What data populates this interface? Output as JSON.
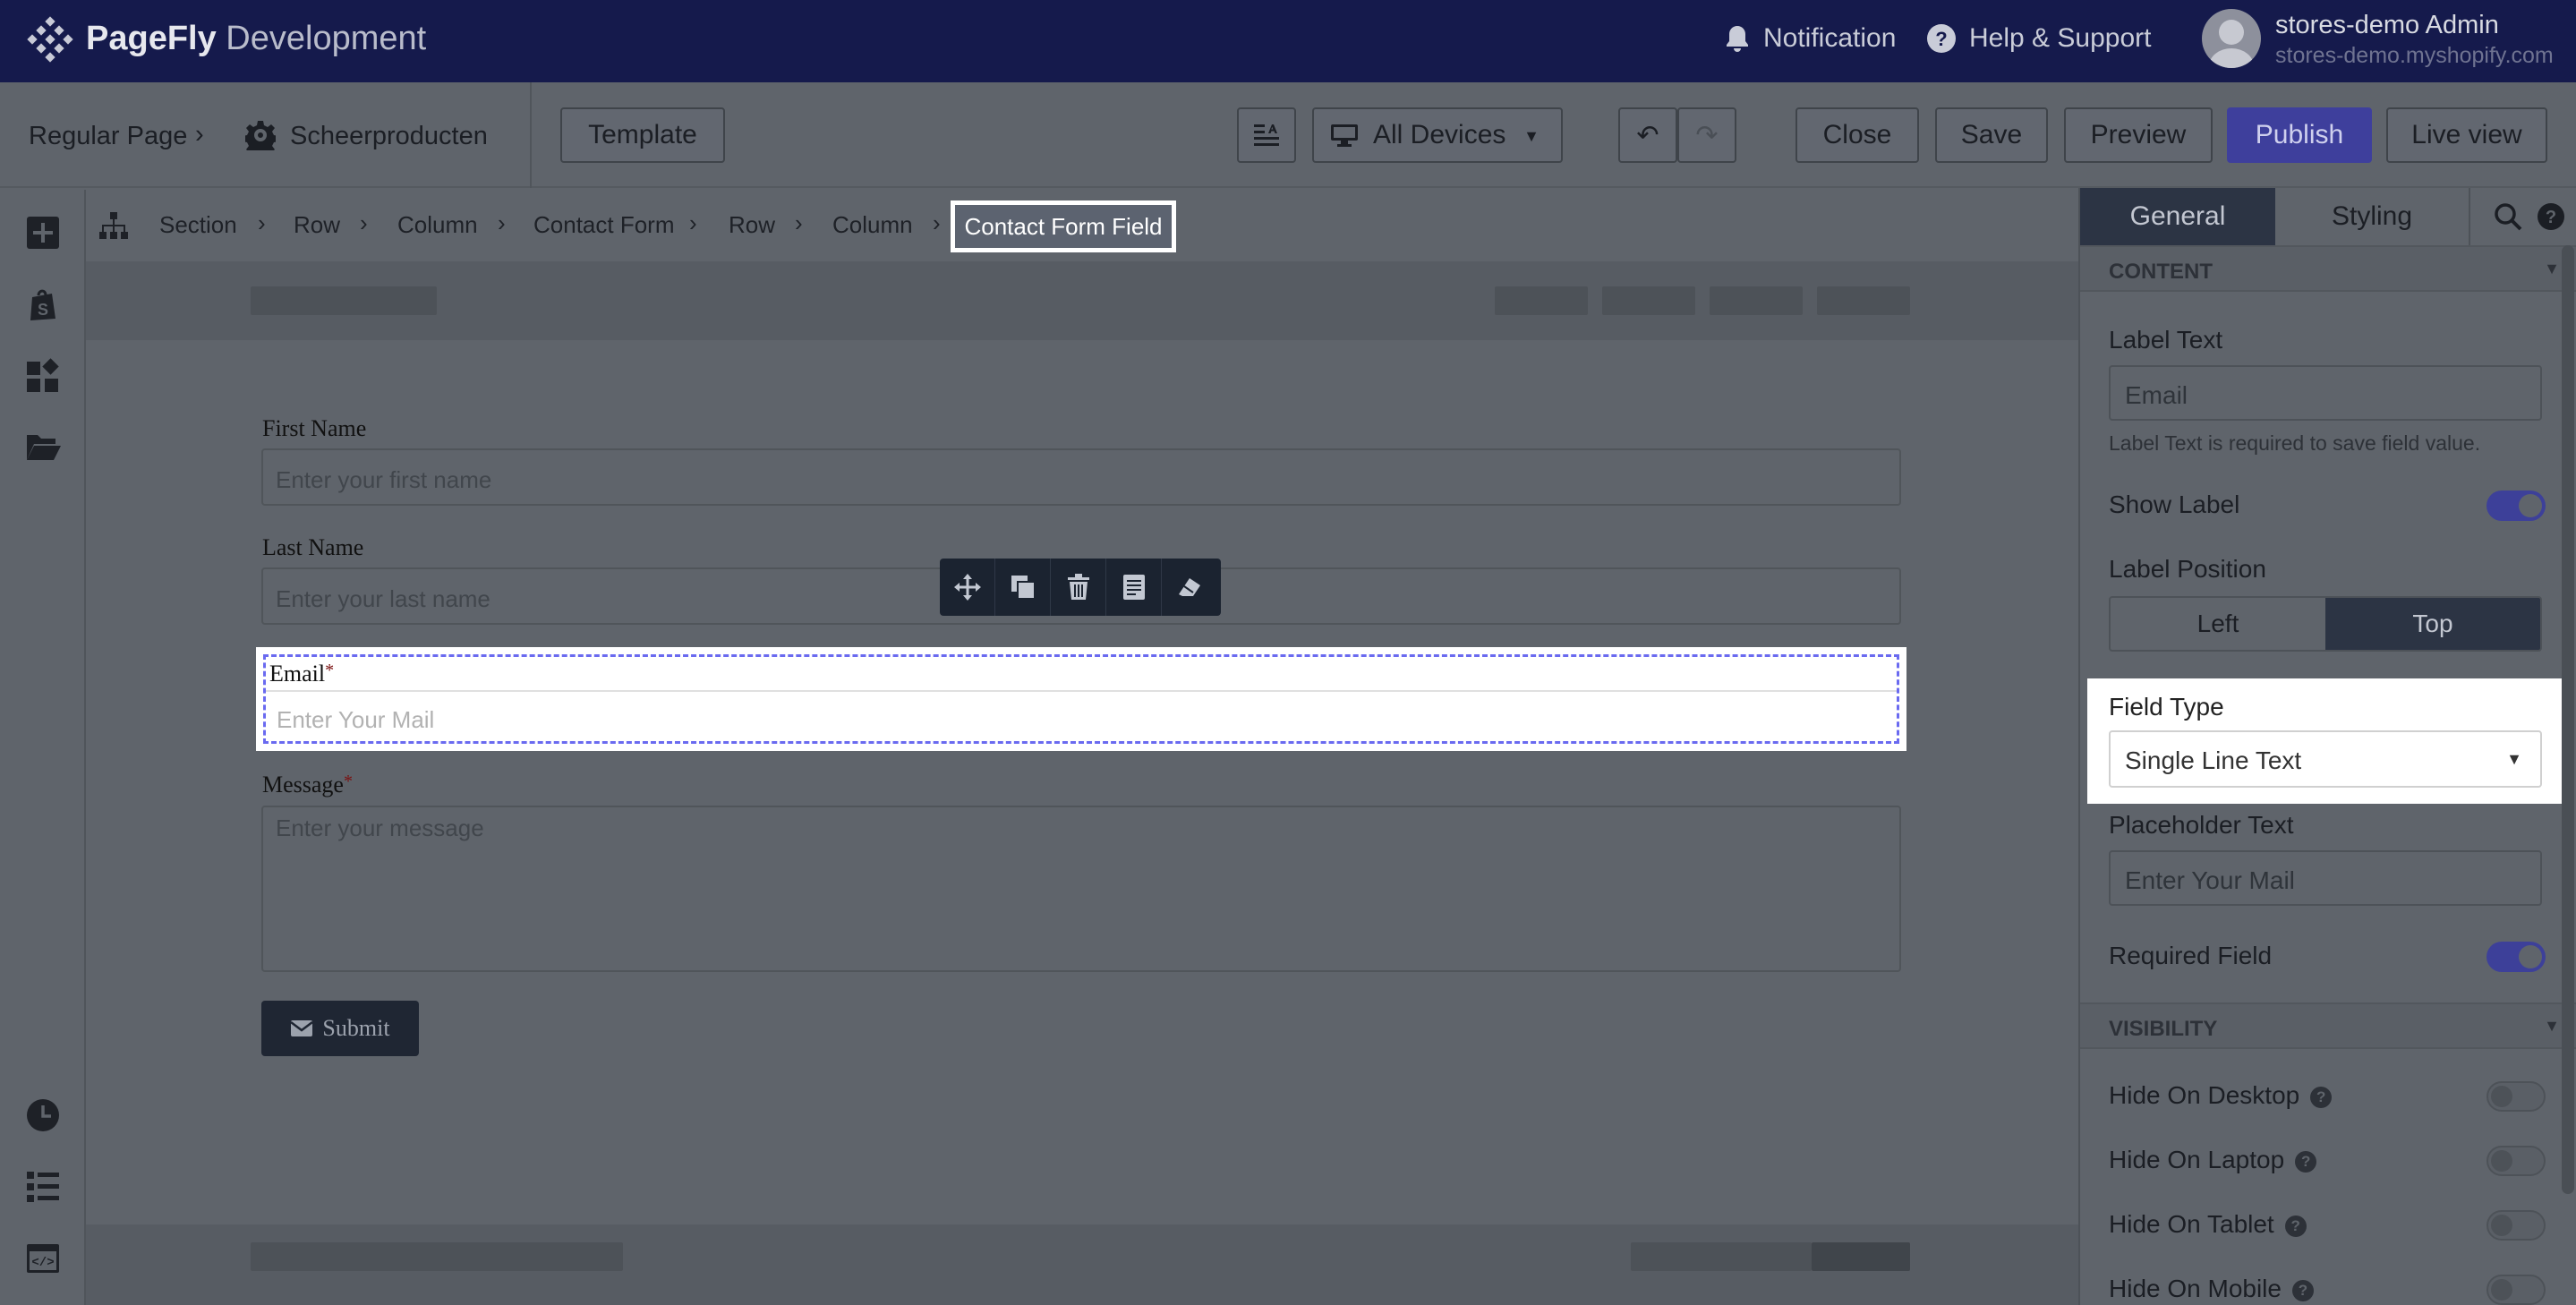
{
  "app": {
    "brand_bold": "PageFly",
    "brand_rest": " Development",
    "notification": "Notification",
    "help": "Help & Support",
    "user_name": "stores-demo Admin",
    "user_shop": "stores-demo.myshopify.com"
  },
  "toolbar": {
    "page_type": "Regular Page",
    "page_name": "Scheerproducten",
    "template": "Template",
    "devices": "All Devices",
    "undo_glyph": "↶",
    "redo_glyph": "↷",
    "close": "Close",
    "save": "Save",
    "preview": "Preview",
    "publish": "Publish",
    "live_view": "Live view"
  },
  "breadcrumb": {
    "items": [
      "Section",
      "Row",
      "Column",
      "Contact Form",
      "Row",
      "Column"
    ],
    "active": "Contact Form Field"
  },
  "form": {
    "first_name_label": "First Name",
    "first_name_placeholder": "Enter your first name",
    "last_name_label": "Last Name",
    "last_name_placeholder": "Enter your last name",
    "email_label": "Email",
    "email_placeholder": "Enter Your Mail",
    "message_label": "Message",
    "message_placeholder": "Enter your message",
    "required_mark": "*",
    "submit": "Submit"
  },
  "panel": {
    "tab_general": "General",
    "tab_styling": "Styling",
    "content_header": "CONTENT",
    "label_text_label": "Label Text",
    "label_text_value": "Email",
    "label_text_hint": "Label Text is required to save field value.",
    "show_label": "Show Label",
    "show_label_on": true,
    "label_position": "Label Position",
    "pos_left": "Left",
    "pos_top": "Top",
    "pos_selected": "Top",
    "field_type_label": "Field Type",
    "field_type_value": "Single Line Text",
    "placeholder_label": "Placeholder Text",
    "placeholder_value": "Enter Your Mail",
    "required_field": "Required Field",
    "required_on": true,
    "visibility_header": "VISIBILITY",
    "hide_desktop": "Hide On Desktop",
    "hide_laptop": "Hide On Laptop",
    "hide_tablet": "Hide On Tablet",
    "hide_mobile": "Hide On Mobile"
  },
  "colors": {
    "topbar": "#151a4c",
    "publish": "#3e3f9c",
    "selection_dash": "#6a6af0"
  }
}
